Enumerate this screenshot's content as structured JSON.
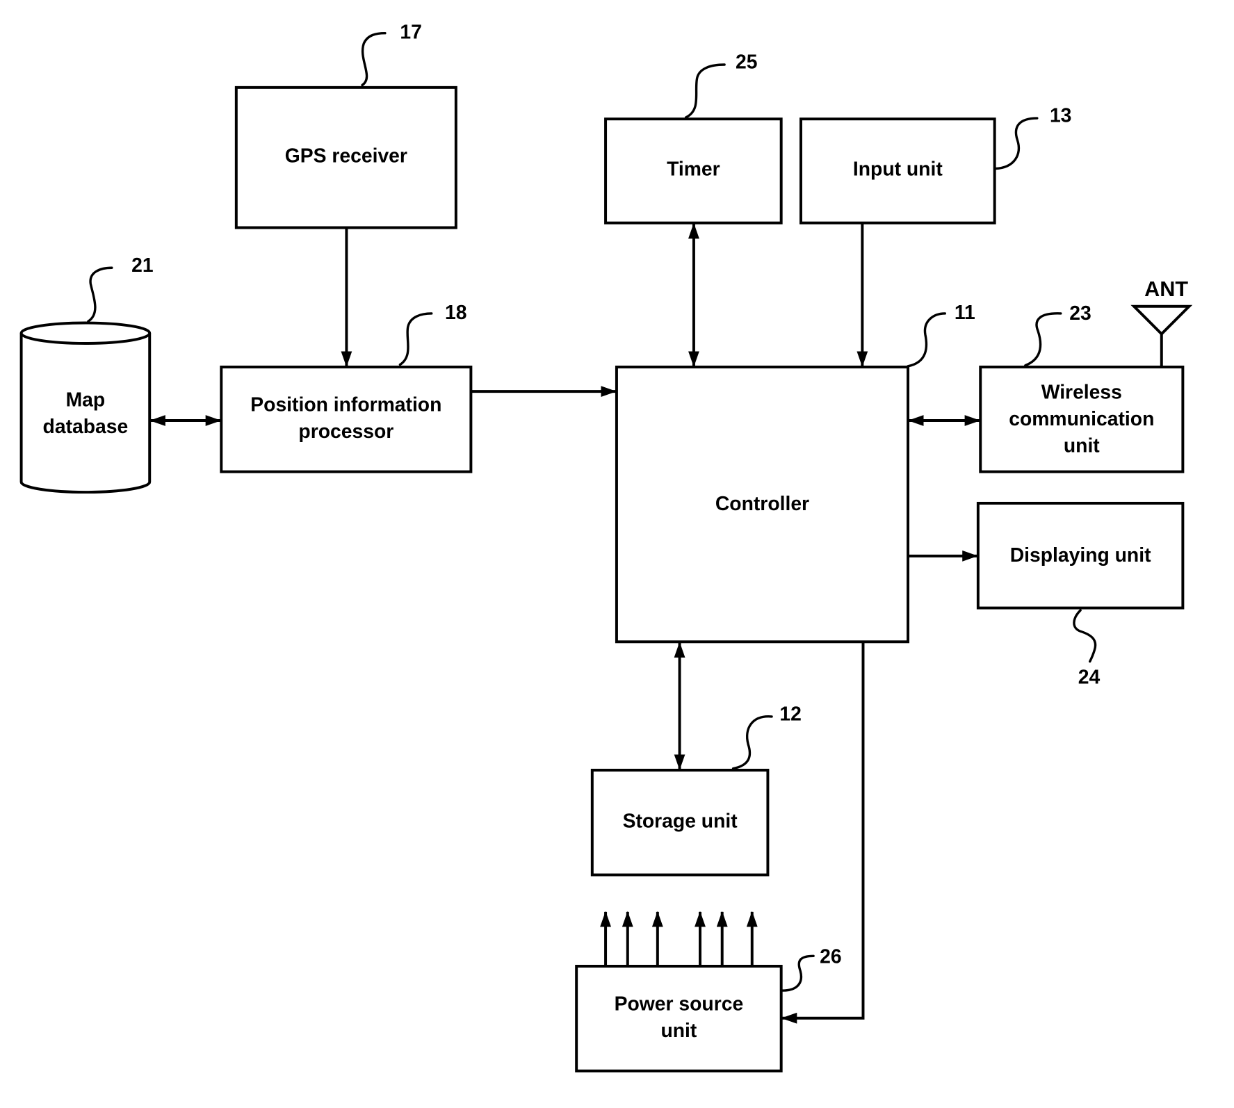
{
  "diagram": {
    "type": "block-diagram",
    "blocks": {
      "gps_receiver": {
        "label": [
          "GPS receiver"
        ],
        "ref": "17"
      },
      "position_processor": {
        "label": [
          "Position information",
          "processor"
        ],
        "ref": "18"
      },
      "map_database": {
        "label": [
          "Map",
          "database"
        ],
        "ref": "21",
        "shape": "cylinder"
      },
      "timer": {
        "label": [
          "Timer"
        ],
        "ref": "25"
      },
      "input_unit": {
        "label": [
          "Input unit"
        ],
        "ref": "13"
      },
      "controller": {
        "label": [
          "Controller"
        ],
        "ref": "11"
      },
      "wireless_unit": {
        "label": [
          "Wireless",
          "communication",
          "unit"
        ],
        "ref": "23"
      },
      "displaying_unit": {
        "label": [
          "Displaying unit"
        ],
        "ref": "24"
      },
      "storage_unit": {
        "label": [
          "Storage unit"
        ],
        "ref": "12"
      },
      "power_source_unit": {
        "label": [
          "Power source",
          "unit"
        ],
        "ref": "26"
      }
    },
    "antenna": {
      "label": "ANT",
      "attached_to": "wireless_unit"
    },
    "connections": [
      {
        "from": "gps_receiver",
        "to": "position_processor",
        "direction": "one-way"
      },
      {
        "from": "map_database",
        "to": "position_processor",
        "direction": "bidirectional"
      },
      {
        "from": "position_processor",
        "to": "controller",
        "direction": "one-way"
      },
      {
        "from": "timer",
        "to": "controller",
        "direction": "bidirectional"
      },
      {
        "from": "input_unit",
        "to": "controller",
        "direction": "one-way"
      },
      {
        "from": "controller",
        "to": "wireless_unit",
        "direction": "bidirectional"
      },
      {
        "from": "controller",
        "to": "displaying_unit",
        "direction": "one-way"
      },
      {
        "from": "controller",
        "to": "storage_unit",
        "direction": "bidirectional"
      },
      {
        "from": "controller",
        "to": "power_source_unit",
        "direction": "one-way"
      }
    ],
    "power_output_arrows": 6
  }
}
